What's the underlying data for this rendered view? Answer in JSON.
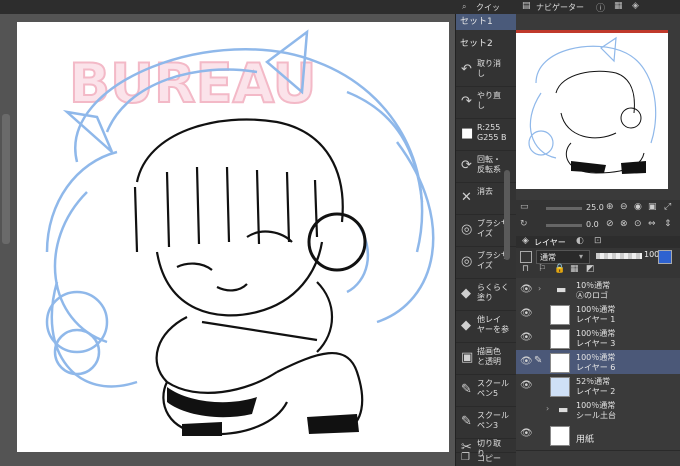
{
  "top_bar": {
    "tab_quick": "クイッ",
    "navigator_tab": "ナビゲーター"
  },
  "sets": [
    "セット1",
    "セット2"
  ],
  "commands": [
    {
      "icon": "undo-icon",
      "glyph": "↶",
      "label": "取り消\nし"
    },
    {
      "icon": "redo-icon",
      "glyph": "↷",
      "label": "やり直\nし"
    },
    {
      "icon": "color-icon",
      "glyph": "■",
      "label": "R:255\nG255 B"
    },
    {
      "icon": "rotate-icon",
      "glyph": "⟳",
      "label": "回転・\n反転系"
    },
    {
      "icon": "eraser-icon",
      "glyph": "✕",
      "label": "消去"
    },
    {
      "icon": "brush-size-icon",
      "glyph": "◎",
      "label": "ブラシサ\nイズ"
    },
    {
      "icon": "brush-size-icon-2",
      "glyph": "◎",
      "label": "ブラシサ\nイズ"
    },
    {
      "icon": "lasso-fill-icon",
      "glyph": "◆",
      "label": "らくらく\n塗り"
    },
    {
      "icon": "fill-icon",
      "glyph": "◆",
      "label": "他レイ\nヤーを参"
    },
    {
      "icon": "draw-color-icon",
      "glyph": "▣",
      "label": "描画色\nと透明"
    },
    {
      "icon": "pen-icon",
      "glyph": "✎",
      "label": "スクール\nペン5"
    },
    {
      "icon": "pen-icon-2",
      "glyph": "✎",
      "label": "スクール\nペン3"
    },
    {
      "icon": "cut-icon",
      "glyph": "✂",
      "label": "切り取\nり"
    },
    {
      "icon": "copy-icon",
      "glyph": "❐",
      "label": "コピー"
    }
  ],
  "navigator": {
    "brush_size": "25.0",
    "opacity": "0.0"
  },
  "layers_panel": {
    "tab_label": "レイヤー",
    "blend_mode": "通常",
    "opacity": "100"
  },
  "layers": [
    {
      "name": "10％通常",
      "sub": "Ⓐのロゴ",
      "folder": true
    },
    {
      "name": "100％通常",
      "sub": "レイヤー 1"
    },
    {
      "name": "100％通常",
      "sub": "レイヤー 3"
    },
    {
      "name": "100％通常",
      "sub": "レイヤー 6",
      "selected": true
    },
    {
      "name": "52％通常",
      "sub": "レイヤー 2"
    },
    {
      "name": "100％通常",
      "sub": "シール土台",
      "folder": true
    },
    {
      "name": "",
      "sub": "用紙"
    }
  ],
  "canvas": {
    "watermark_text": "BUREAU",
    "line_color": "#7fb0ea",
    "ink_color": "#111111"
  }
}
